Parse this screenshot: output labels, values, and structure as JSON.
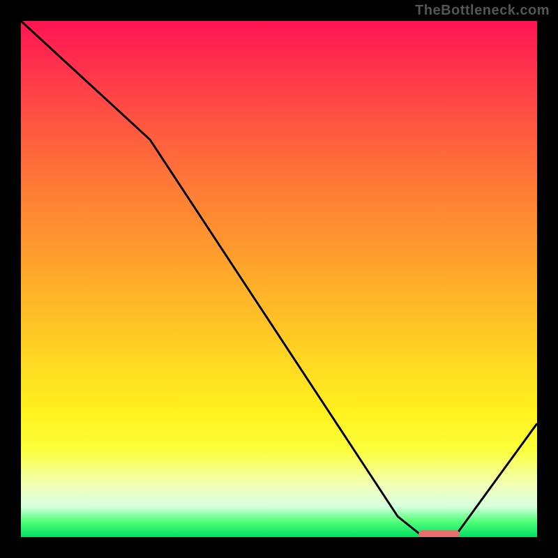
{
  "watermark": "TheBottleneck.com",
  "colors": {
    "background": "#000000",
    "curve": "#000000",
    "marker": "#e3706f"
  },
  "chart_data": {
    "type": "line",
    "title": "",
    "xlabel": "",
    "ylabel": "",
    "xlim": [
      0,
      100
    ],
    "ylim": [
      0,
      100
    ],
    "x": [
      0,
      25,
      73,
      78,
      84,
      100
    ],
    "values": [
      100,
      77,
      4,
      0,
      0,
      22
    ],
    "marker": {
      "x_start": 77,
      "x_end": 85,
      "y": 0
    },
    "gradient_stops": [
      {
        "pos": 0,
        "color": "#ff1452"
      },
      {
        "pos": 8,
        "color": "#ff2f4e"
      },
      {
        "pos": 20,
        "color": "#ff5640"
      },
      {
        "pos": 32,
        "color": "#ff7a36"
      },
      {
        "pos": 44,
        "color": "#ff9a2e"
      },
      {
        "pos": 55,
        "color": "#ffb928"
      },
      {
        "pos": 66,
        "color": "#ffd822"
      },
      {
        "pos": 76,
        "color": "#fff21e"
      },
      {
        "pos": 83,
        "color": "#fbff3a"
      },
      {
        "pos": 90,
        "color": "#f2ffb7"
      },
      {
        "pos": 94,
        "color": "#d8ffdf"
      },
      {
        "pos": 97,
        "color": "#51ff7a"
      },
      {
        "pos": 100,
        "color": "#00e060"
      }
    ]
  }
}
